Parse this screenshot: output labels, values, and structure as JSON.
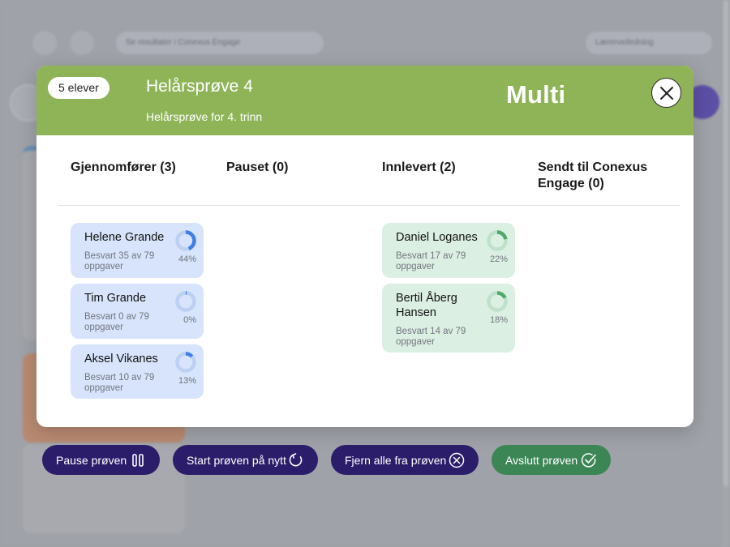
{
  "modal": {
    "count_badge": "5 elever",
    "title": "Helårsprøve 4",
    "subtitle": "Helårsprøve for 4. trinn",
    "logo": "Multi",
    "close_icon": "close-icon"
  },
  "columns": [
    {
      "title": "Gjennomfører (3)"
    },
    {
      "title": "Pauset (0)"
    },
    {
      "title": "Innlevert (2)"
    },
    {
      "title": "Sendt til Conexus Engage (0)"
    }
  ],
  "students_in_progress": [
    {
      "name": "Helene Grande",
      "progress_text": "Besvart 35 av 79 oppgaver",
      "percent_label": "44%",
      "percent": 44
    },
    {
      "name": "Tim Grande",
      "progress_text": "Besvart 0 av 79 oppgaver",
      "percent_label": "0%",
      "percent": 0
    },
    {
      "name": "Aksel Vikanes",
      "progress_text": "Besvart 10 av 79 oppgaver",
      "percent_label": "13%",
      "percent": 13
    }
  ],
  "students_submitted": [
    {
      "name": "Daniel Loganes",
      "progress_text": "Besvart 17 av 79 oppgaver",
      "percent_label": "22%",
      "percent": 22
    },
    {
      "name": "Bertil Åberg Hansen",
      "progress_text": "Besvart 14 av 79 oppgaver",
      "percent_label": "18%",
      "percent": 18
    }
  ],
  "actions": {
    "pause": {
      "label": "Pause prøven",
      "icon": "pause-icon"
    },
    "restart": {
      "label": "Start prøven på nytt",
      "icon": "restart-icon"
    },
    "remove_all": {
      "label": "Fjern alle fra prøven",
      "icon": "remove-circle-icon"
    },
    "finish": {
      "label": "Avslutt prøven",
      "icon": "check-circle-icon"
    }
  },
  "background": {
    "results_link": "Se resultater i Conexus Engage",
    "teacher_guide": "Lærerveiledning"
  },
  "colors": {
    "header_green": "#8fb458",
    "active_card": "#d7e4fb",
    "done_card": "#dcefe3",
    "ring_blue": "#3f7fe6",
    "ring_green": "#4fa86c",
    "button_dark": "#2c1d6b",
    "button_green": "#3c8656"
  }
}
